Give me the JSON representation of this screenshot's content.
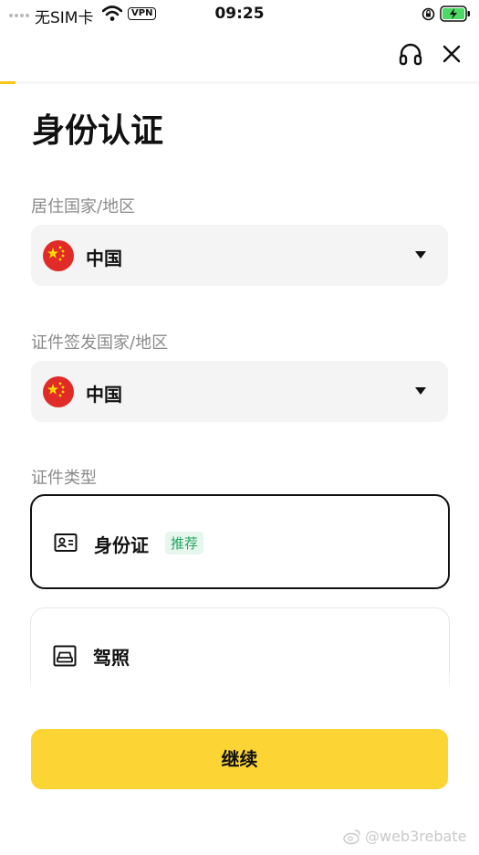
{
  "status_bar": {
    "carrier": "无SIM卡",
    "vpn": "VPN",
    "time": "09:25"
  },
  "nav": {
    "support_icon": "headset-icon",
    "close_icon": "close-icon"
  },
  "progress": {
    "fraction": 0.033,
    "color": "#f5c518"
  },
  "title": "身份认证",
  "residence": {
    "label": "居住国家/地区",
    "value": "中国",
    "flag_icon": "china-flag-icon"
  },
  "issuing": {
    "label": "证件签发国家/地区",
    "value": "中国",
    "flag_icon": "china-flag-icon"
  },
  "doc_type": {
    "label": "证件类型",
    "options": [
      {
        "label": "身份证",
        "badge": "推荐",
        "icon": "id-card-icon",
        "selected": true
      },
      {
        "label": "驾照",
        "icon": "car-icon",
        "selected": false
      }
    ]
  },
  "continue_label": "继续",
  "watermark": "@web3rebate",
  "colors": {
    "accent": "#fcd535",
    "badge_green": "#27a463",
    "flag_red": "#e02b28"
  }
}
